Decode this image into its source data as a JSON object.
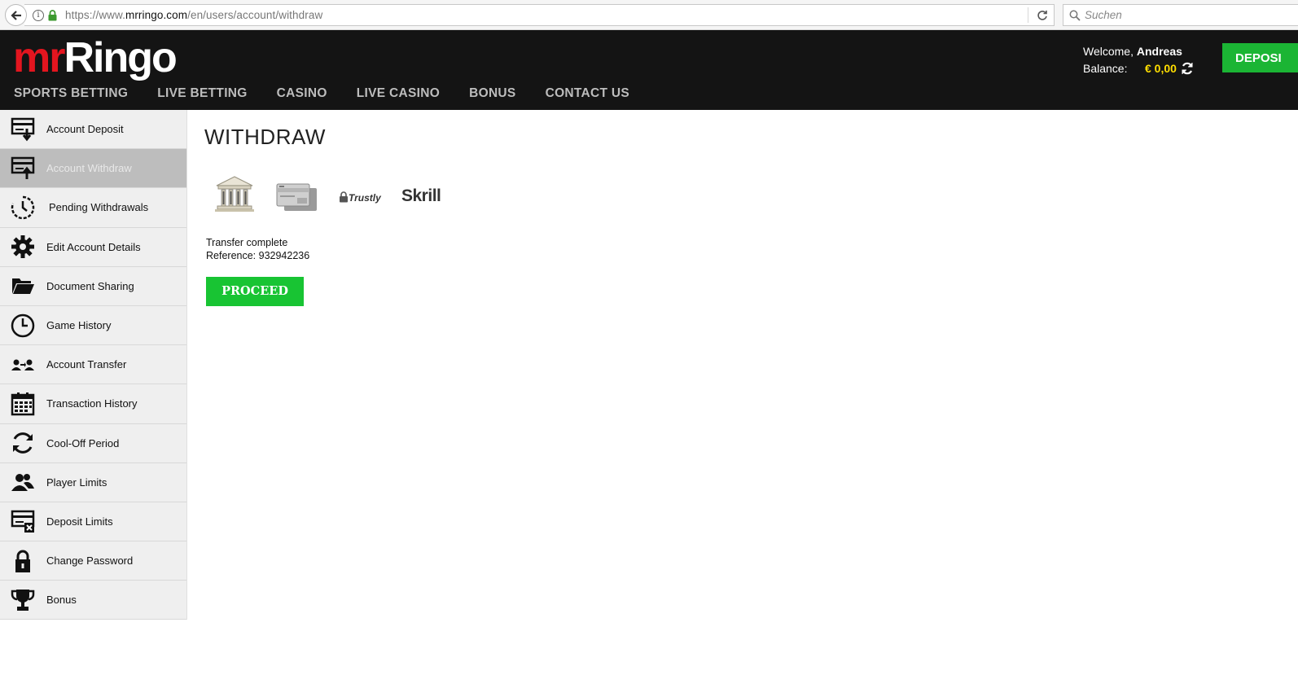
{
  "browser": {
    "url_prefix": "https://www.",
    "url_host": "mrringo.com",
    "url_path": "/en/users/account/withdraw",
    "search_placeholder": "Suchen"
  },
  "header": {
    "logo_mr": "mr",
    "logo_ringo": "Ringo",
    "welcome_prefix": "Welcome, ",
    "username": "Andreas",
    "balance_label": "Balance:",
    "balance_value": "€ 0,00",
    "deposit_button": "DEPOSI",
    "nav": [
      "SPORTS BETTING",
      "LIVE BETTING",
      "CASINO",
      "LIVE CASINO",
      "BONUS",
      "CONTACT US"
    ]
  },
  "sidebar": {
    "items": [
      {
        "label": "Account Deposit",
        "icon": "deposit-icon"
      },
      {
        "label": "Account Withdraw",
        "icon": "withdraw-icon",
        "active": true
      },
      {
        "label": "Pending Withdrawals",
        "icon": "pending-clock-icon"
      },
      {
        "label": "Edit Account Details",
        "icon": "gear-icon"
      },
      {
        "label": "Document Sharing",
        "icon": "folder-icon"
      },
      {
        "label": "Game History",
        "icon": "clock-icon"
      },
      {
        "label": "Account Transfer",
        "icon": "transfer-icon"
      },
      {
        "label": "Transaction History",
        "icon": "calendar-icon"
      },
      {
        "label": "Cool-Off Period",
        "icon": "refresh-icon"
      },
      {
        "label": "Player Limits",
        "icon": "users-icon"
      },
      {
        "label": "Deposit Limits",
        "icon": "card-limit-icon"
      },
      {
        "label": "Change Password",
        "icon": "lock-icon"
      },
      {
        "label": "Bonus",
        "icon": "trophy-icon"
      }
    ]
  },
  "main": {
    "title": "WITHDRAW",
    "payment_methods": {
      "trustly": "Trustly",
      "skrill": "Skrill"
    },
    "status_line1": "Transfer complete",
    "status_line2": "Reference: 932942236",
    "proceed_button": "PROCEED"
  },
  "colors": {
    "header_bg": "#141414",
    "brand_red": "#e3151f",
    "deposit_green": "#1bb534",
    "proceed_green": "#18c433",
    "balance_yellow": "#ffde00",
    "sidebar_bg": "#efefef",
    "sidebar_active": "#bdbdbd"
  }
}
